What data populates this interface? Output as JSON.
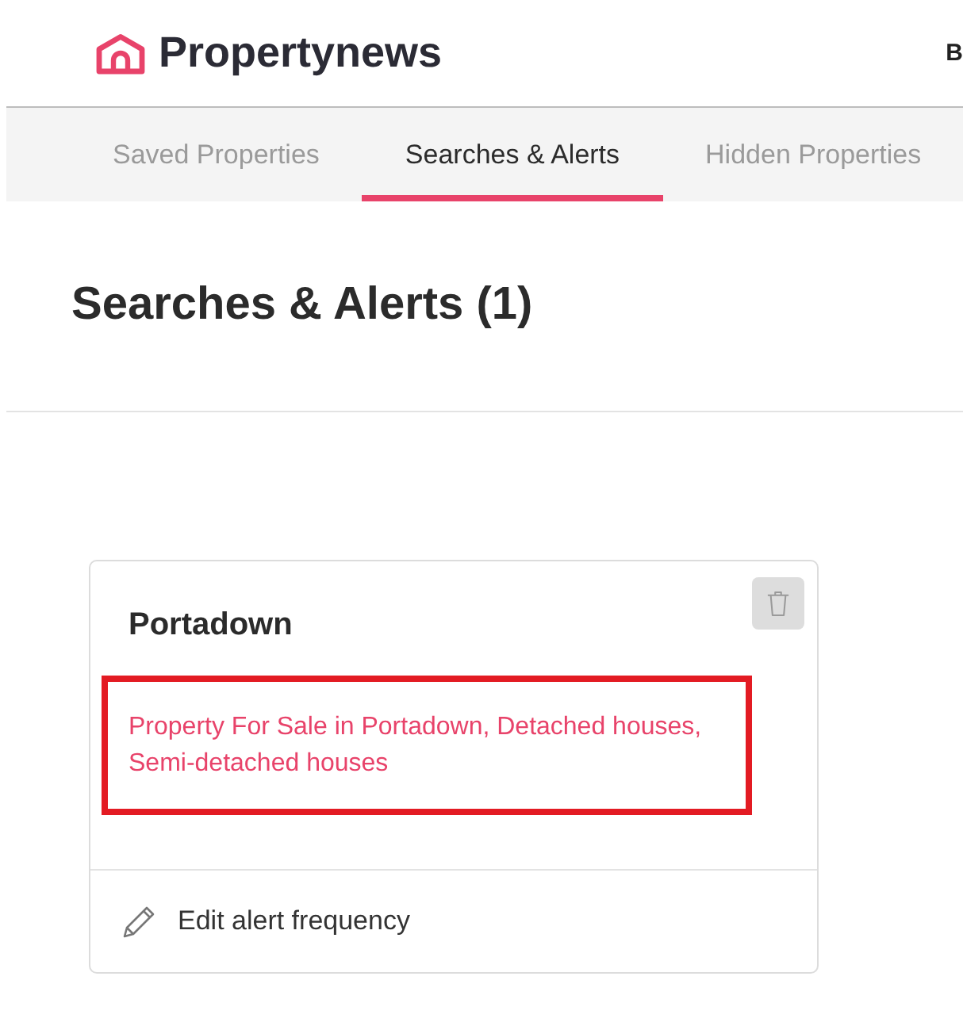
{
  "header": {
    "logo": "Propertynews",
    "nav_link": "B"
  },
  "tabs": [
    {
      "label": "Saved Properties",
      "selected": false
    },
    {
      "label": "Searches & Alerts",
      "selected": true
    },
    {
      "label": "Hidden Properties",
      "selected": false
    }
  ],
  "page": {
    "title": "Searches & Alerts (1)"
  },
  "alerts": [
    {
      "name": "Portadown",
      "search": "Property For Sale in Portadown, Detached houses, Semi-detached houses",
      "highlighted": true,
      "action": "Edit alert frequency"
    }
  ]
}
